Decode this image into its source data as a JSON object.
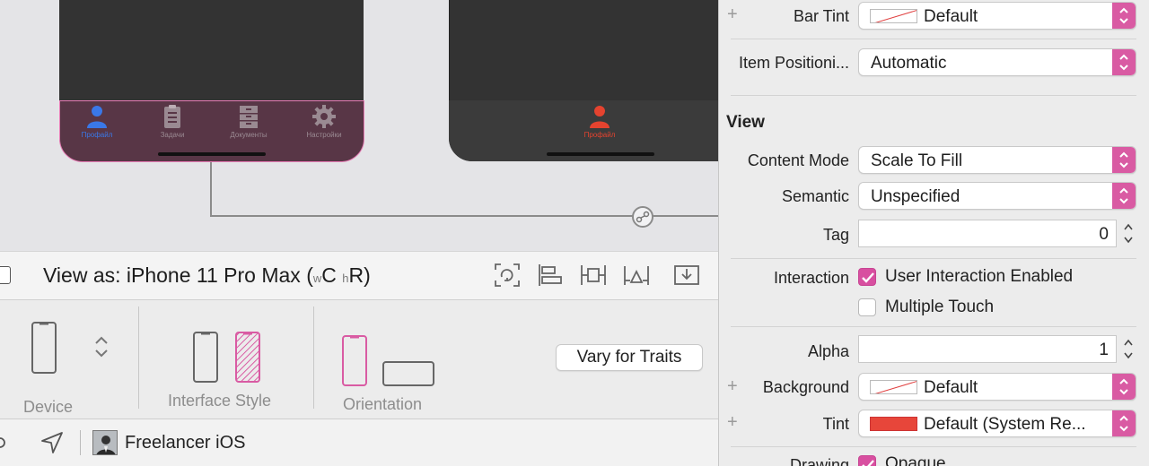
{
  "canvas": {
    "phone1_tabs": [
      {
        "label": "Профайл",
        "icon": "person-icon",
        "active": true
      },
      {
        "label": "Задачи",
        "icon": "clipboard-icon",
        "active": false
      },
      {
        "label": "Документы",
        "icon": "cabinet-icon",
        "active": false
      },
      {
        "label": "Настройки",
        "icon": "gear-icon",
        "active": false
      }
    ],
    "phone2_tab": {
      "label": "Профайл",
      "icon": "person-icon"
    }
  },
  "viewas": {
    "prefix": "View as: iPhone 11 Pro Max (",
    "w_small": "w",
    "w_val": "C",
    "h_small": "h",
    "h_val": "R",
    "suffix": ")"
  },
  "traits": {
    "device_label": "Device",
    "interface_style_label": "Interface Style",
    "orientation_label": "Orientation",
    "vary_button": "Vary for Traits"
  },
  "bottom": {
    "project_name": "Freelancer iOS"
  },
  "inspector": {
    "bar_tint": {
      "label": "Bar Tint",
      "value": "Default"
    },
    "item_positioning": {
      "label": "Item Positioni...",
      "value": "Automatic"
    },
    "section_view": "View",
    "content_mode": {
      "label": "Content Mode",
      "value": "Scale To Fill"
    },
    "semantic": {
      "label": "Semantic",
      "value": "Unspecified"
    },
    "tag": {
      "label": "Tag",
      "value": "0"
    },
    "interaction": {
      "label": "Interaction",
      "user_interaction": "User Interaction Enabled",
      "multiple_touch": "Multiple Touch"
    },
    "alpha": {
      "label": "Alpha",
      "value": "1"
    },
    "background": {
      "label": "Background",
      "value": "Default"
    },
    "tint": {
      "label": "Tint",
      "value": "Default (System Re..."
    },
    "drawing": {
      "label": "Drawing",
      "value": "Opaque"
    }
  },
  "colors": {
    "accent": "#d95ba3",
    "active_tab": "#3a78e8",
    "red_tab": "#e5432f"
  }
}
